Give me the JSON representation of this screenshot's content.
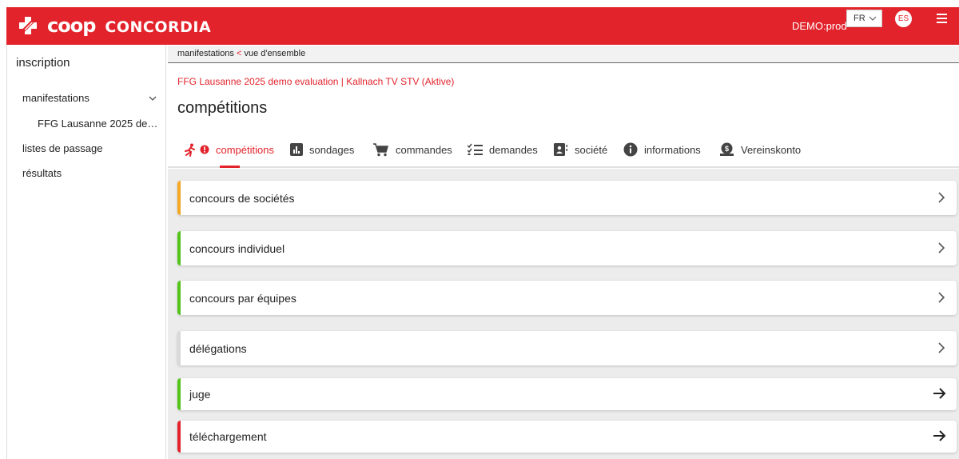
{
  "header": {
    "brand": {
      "coop": "coop",
      "concordia": "CONCORDIA"
    },
    "env_label": "DEMO:prod",
    "language": "FR",
    "avatar_initials": "ES",
    "bg_color": "#e2232b"
  },
  "sidebar": {
    "title": "inscription",
    "items": [
      {
        "label": "manifestations"
      },
      {
        "label": "FFG Lausanne 2025 de…"
      },
      {
        "label": "listes de passage"
      },
      {
        "label": "résultats"
      }
    ]
  },
  "breadcrumb": {
    "parent": "manifestations",
    "separator": "<",
    "current": "vue d'ensemble"
  },
  "event_link": "FFG Lausanne 2025 demo evaluation | Kallnach TV STV (Aktive)",
  "page_title": "compétitions",
  "tabs": [
    {
      "label": "compétitions",
      "icon": "runner-icon",
      "active": true
    },
    {
      "label": "sondages",
      "icon": "poll-icon"
    },
    {
      "label": "commandes",
      "icon": "cart-icon"
    },
    {
      "label": "demandes",
      "icon": "checklist-icon"
    },
    {
      "label": "société",
      "icon": "contact-card-icon"
    },
    {
      "label": "informations",
      "icon": "info-icon"
    },
    {
      "label": "Vereinskonto",
      "icon": "money-icon"
    }
  ],
  "cards": [
    {
      "label": "concours de sociétés",
      "status_color": "#f5a623",
      "arrow": "chevron"
    },
    {
      "label": "concours individuel",
      "status_color": "#52c41a",
      "arrow": "chevron"
    },
    {
      "label": "concours par équipes",
      "status_color": "#52c41a",
      "arrow": "chevron"
    },
    {
      "label": "délégations",
      "status_color": "#d9d9d9",
      "arrow": "chevron"
    },
    {
      "label": "juge",
      "status_color": "#52c41a",
      "arrow": "arrow"
    },
    {
      "label": "téléchargement",
      "status_color": "#e2232b",
      "arrow": "arrow"
    }
  ]
}
